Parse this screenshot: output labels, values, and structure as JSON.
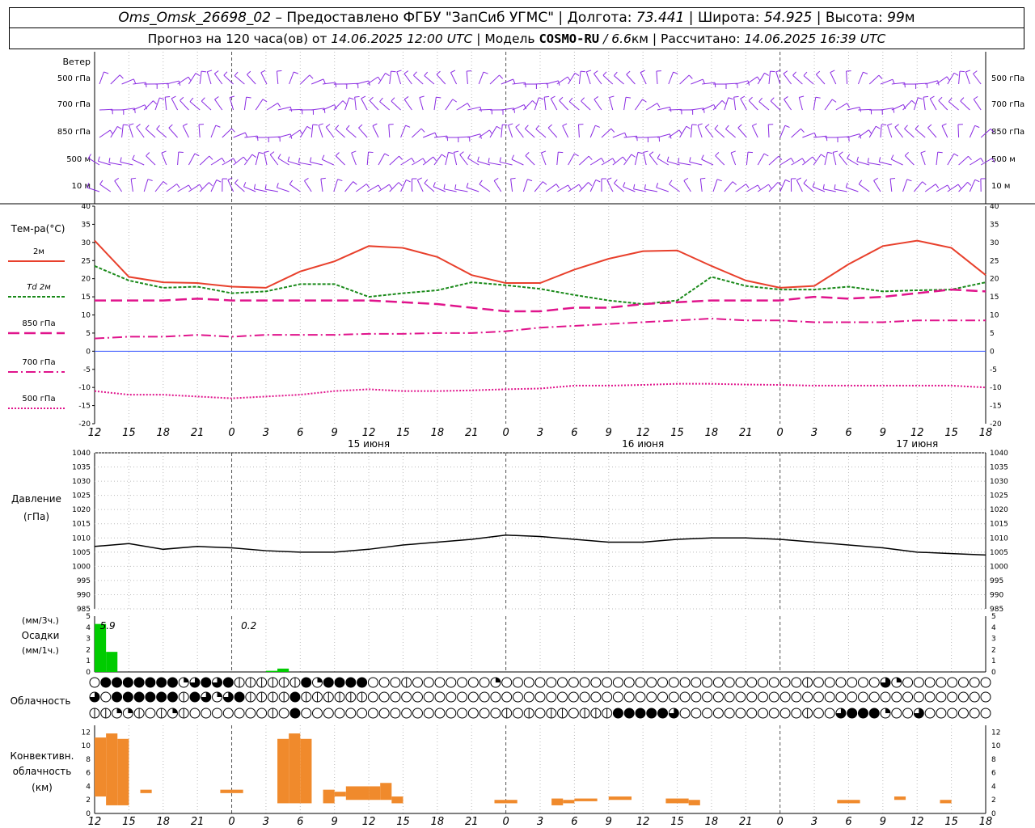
{
  "header": {
    "station": "Oms_Omsk_26698_02",
    "provider": "– Предоставлено ФГБУ \"ЗапСиб УГМС\"",
    "lon_label": "Долгота:",
    "lon": "73.441",
    "lat_label": "Широта:",
    "lat": "54.925",
    "alt_label": "Высота:",
    "alt": "99",
    "alt_unit": "м",
    "forecast_label": "Прогноз на 120 часа(ов)  от",
    "forecast_start": "14.06.2025 12:00 UTC",
    "model_label": "Модель",
    "model_name": "COSMO-RU",
    "model_res": "/ 6.6",
    "model_res_unit": "км",
    "calc_label": "Рассчитано:",
    "calc_time": "14.06.2025 16:39 UTC"
  },
  "chart_data": [
    {
      "type": "wind_barbs",
      "title": "Ветер",
      "levels": [
        "500 гПа",
        "700 гПа",
        "850 гПа",
        "500  м",
        "10   м"
      ]
    },
    {
      "type": "line",
      "ylabel": "Тем-ра(°C)",
      "ylim": [
        -20,
        40
      ],
      "yticks": [
        -20,
        -15,
        -10,
        -5,
        0,
        5,
        10,
        15,
        20,
        25,
        30,
        35,
        40
      ],
      "x_ticks": [
        "12",
        "15",
        "18",
        "21",
        "0",
        "3",
        "6",
        "9",
        "12",
        "15",
        "18",
        "21",
        "0",
        "3",
        "6",
        "9",
        "12",
        "15",
        "18",
        "21",
        "0",
        "3",
        "6",
        "9",
        "12",
        "15",
        "18"
      ],
      "date_labels": [
        "15 июня",
        "16 июня",
        "17 июня"
      ],
      "x_hours": [
        0,
        3,
        6,
        9,
        12,
        15,
        18,
        21,
        24,
        27,
        30,
        33,
        36,
        39,
        42,
        45,
        48,
        51,
        54,
        57,
        60,
        63,
        66,
        69,
        72,
        75,
        78
      ],
      "series": [
        {
          "name": "2м",
          "values": [
            30.5,
            20.5,
            19,
            18.8,
            17.8,
            17.5,
            22,
            24.8,
            29,
            28.5,
            26,
            21,
            18.8,
            18.8,
            22.5,
            25.5,
            27.6,
            27.8,
            23.5,
            19.5,
            17.5,
            18,
            24,
            29,
            30.5,
            28.5,
            21
          ]
        },
        {
          "name": "Td  2м",
          "values": [
            23.5,
            19.5,
            17.5,
            17.8,
            16,
            16.5,
            18.5,
            18.5,
            15,
            16,
            16.8,
            19,
            18.2,
            17.2,
            15.5,
            14,
            13,
            14,
            20.5,
            18,
            17,
            17,
            17.8,
            16.5,
            16.8,
            17,
            19
          ]
        },
        {
          "name": "850 гПа",
          "values": [
            14,
            14,
            14,
            14.5,
            14,
            14,
            14,
            14,
            14,
            13.5,
            13,
            12,
            11,
            11,
            12,
            12,
            13,
            13.5,
            14,
            14,
            14,
            15,
            14.5,
            15,
            16,
            17,
            16.5
          ]
        },
        {
          "name": "700 гПа",
          "values": [
            3.5,
            4,
            4,
            4.5,
            4,
            4.5,
            4.5,
            4.5,
            4.8,
            4.8,
            5,
            5,
            5.5,
            6.5,
            7,
            7.5,
            8,
            8.5,
            9,
            8.5,
            8.5,
            8,
            8,
            8,
            8.5,
            8.5,
            8.5
          ]
        },
        {
          "name": "500 гПа",
          "values": [
            -11,
            -12,
            -12,
            -12.5,
            -13,
            -12.5,
            -12,
            -11,
            -10.5,
            -11,
            -11,
            -10.8,
            -10.5,
            -10.3,
            -9.5,
            -9.5,
            -9.3,
            -9,
            -9,
            -9.2,
            -9.3,
            -9.5,
            -9.5,
            -9.5,
            -9.5,
            -9.5,
            -10
          ]
        }
      ],
      "colors": [
        "#e8402c",
        "#1a8a1a",
        "#e0148c",
        "#e0148c",
        "#e0148c"
      ]
    },
    {
      "type": "line",
      "ylabel": "Давление",
      "ylabel2": "(гПа)",
      "ylim": [
        985,
        1040
      ],
      "yticks": [
        985,
        990,
        995,
        1000,
        1005,
        1010,
        1015,
        1020,
        1025,
        1030,
        1035,
        1040
      ],
      "series": [
        {
          "name": "Давление",
          "values": [
            1007,
            1008,
            1006,
            1007,
            1006.5,
            1005.5,
            1005,
            1005,
            1006,
            1007.5,
            1008.5,
            1009.5,
            1011,
            1010.5,
            1009.5,
            1008.5,
            1008.5,
            1009.5,
            1010,
            1010,
            1009.5,
            1008.5,
            1007.5,
            1006.5,
            1005,
            1004.5,
            1004
          ]
        }
      ],
      "colors": [
        "#000000"
      ]
    },
    {
      "type": "bar",
      "ylabel": "Осадки",
      "ylabel_top": "(мм/3ч.)",
      "ylabel_bottom": "(мм/1ч.)",
      "ylim": [
        0,
        5
      ],
      "yticks": [
        0,
        1,
        2,
        3,
        4,
        5
      ],
      "totals": [
        "5.9",
        "0.2"
      ],
      "bars": [
        {
          "x0": 0,
          "x1": 1,
          "value": 4.3
        },
        {
          "x0": 1,
          "x1": 2,
          "value": 1.8
        },
        {
          "x0": 15,
          "x1": 16,
          "value": 0.1
        },
        {
          "x0": 16,
          "x1": 17,
          "value": 0.3
        }
      ],
      "colors": [
        "#00cc00"
      ]
    },
    {
      "type": "cloud_circles",
      "title": "Облачность",
      "rows": [
        [
          0,
          4,
          4,
          4,
          4,
          4,
          4,
          4,
          2,
          3,
          4,
          3,
          4,
          1,
          1,
          1,
          1,
          1,
          1,
          4,
          2,
          4,
          4,
          4,
          4,
          0,
          0,
          0,
          1,
          0,
          0,
          0,
          0,
          0,
          0,
          0,
          2,
          0,
          0,
          0,
          0,
          0,
          0,
          0,
          0,
          0,
          0,
          0,
          0,
          0,
          0,
          0,
          0,
          0,
          0,
          0,
          0,
          0,
          0,
          0,
          0,
          0,
          0,
          0,
          1,
          0,
          0,
          0,
          0,
          0,
          0,
          3,
          2,
          0,
          0,
          0,
          0,
          0,
          0,
          0,
          0
        ],
        [
          3,
          0,
          4,
          4,
          4,
          4,
          4,
          4,
          1,
          4,
          3,
          2,
          3,
          4,
          1,
          1,
          1,
          1,
          4,
          1,
          1,
          1,
          1,
          1,
          1,
          0,
          0,
          0,
          0,
          0,
          0,
          0,
          0,
          0,
          0,
          0,
          0,
          0,
          0,
          0,
          0,
          0,
          0,
          0,
          0,
          0,
          0,
          0,
          0,
          0,
          0,
          0,
          0,
          0,
          0,
          0,
          0,
          0,
          0,
          0,
          0,
          0,
          0,
          0,
          0,
          0,
          0,
          0,
          0,
          0,
          0,
          0,
          0,
          0,
          0,
          0,
          0,
          0,
          0,
          0,
          0
        ],
        [
          1,
          1,
          2,
          2,
          1,
          0,
          1,
          2,
          1,
          0,
          0,
          0,
          0,
          0,
          0,
          0,
          1,
          0,
          4,
          0,
          0,
          0,
          0,
          0,
          0,
          0,
          0,
          0,
          0,
          0,
          0,
          0,
          0,
          0,
          0,
          0,
          0,
          1,
          0,
          1,
          0,
          1,
          1,
          0,
          1,
          1,
          1,
          4,
          4,
          4,
          4,
          4,
          3,
          0,
          0,
          0,
          0,
          0,
          0,
          0,
          0,
          0,
          0,
          0,
          1,
          0,
          0,
          3,
          4,
          4,
          4,
          2,
          0,
          0,
          3,
          0,
          0,
          0,
          0,
          0,
          0
        ]
      ]
    },
    {
      "type": "bar",
      "ylabel": "Конвективн.",
      "ylabel2": "облачность",
      "ylabel3": "(км)",
      "ylim": [
        0,
        13
      ],
      "yticks": [
        0,
        2,
        4,
        6,
        8,
        10,
        12
      ],
      "bars": [
        {
          "x0": 0,
          "x1": 1,
          "lo": 2.5,
          "hi": 11.2
        },
        {
          "x0": 1,
          "x1": 2,
          "lo": 1.2,
          "hi": 11.8
        },
        {
          "x0": 2,
          "x1": 3,
          "lo": 1.2,
          "hi": 11
        },
        {
          "x0": 4,
          "x1": 5,
          "lo": 3,
          "hi": 3.5
        },
        {
          "x0": 11,
          "x1": 13,
          "lo": 3,
          "hi": 3.5
        },
        {
          "x0": 16,
          "x1": 17,
          "lo": 1.5,
          "hi": 11
        },
        {
          "x0": 17,
          "x1": 18,
          "lo": 1.5,
          "hi": 11.8
        },
        {
          "x0": 18,
          "x1": 19,
          "lo": 1.5,
          "hi": 11
        },
        {
          "x0": 20,
          "x1": 21,
          "lo": 1.5,
          "hi": 3.5
        },
        {
          "x0": 21,
          "x1": 22,
          "lo": 2.5,
          "hi": 3.2
        },
        {
          "x0": 22,
          "x1": 24,
          "lo": 2,
          "hi": 4
        },
        {
          "x0": 24,
          "x1": 25,
          "lo": 2,
          "hi": 4
        },
        {
          "x0": 25,
          "x1": 26,
          "lo": 2,
          "hi": 4.5
        },
        {
          "x0": 26,
          "x1": 27,
          "lo": 1.5,
          "hi": 2.5
        },
        {
          "x0": 35,
          "x1": 37,
          "lo": 1.5,
          "hi": 2
        },
        {
          "x0": 40,
          "x1": 41,
          "lo": 1.2,
          "hi": 2.2
        },
        {
          "x0": 41,
          "x1": 42,
          "lo": 1.5,
          "hi": 2
        },
        {
          "x0": 42,
          "x1": 44,
          "lo": 1.8,
          "hi": 2.2
        },
        {
          "x0": 45,
          "x1": 47,
          "lo": 2,
          "hi": 2.5
        },
        {
          "x0": 50,
          "x1": 52,
          "lo": 1.5,
          "hi": 2.2
        },
        {
          "x0": 52,
          "x1": 53,
          "lo": 1.2,
          "hi": 2
        },
        {
          "x0": 65,
          "x1": 67,
          "lo": 1.5,
          "hi": 2
        },
        {
          "x0": 70,
          "x1": 71,
          "lo": 2,
          "hi": 2.5
        },
        {
          "x0": 74,
          "x1": 75,
          "lo": 1.5,
          "hi": 2
        }
      ],
      "colors": [
        "#f08a2c"
      ]
    }
  ]
}
